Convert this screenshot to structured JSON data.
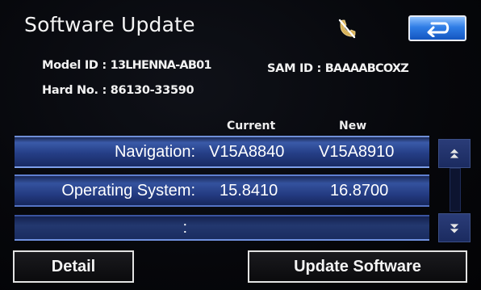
{
  "header": {
    "title": "Software Update"
  },
  "info": {
    "model_id_label": "Model ID :",
    "model_id_value": "13LHENNA-AB01",
    "sam_id_label": "SAM ID :",
    "sam_id_value": "BAAAABCOXZ",
    "hard_no_label": "Hard No. :",
    "hard_no_value": "86130-33590"
  },
  "table": {
    "columns": [
      "Current",
      "New"
    ],
    "rows": [
      {
        "label": "Navigation:",
        "current": "V15A8840",
        "new": "V15A8910"
      },
      {
        "label": "Operating System:",
        "current": "15.8410",
        "new": "16.8700"
      },
      {
        "label": ":",
        "current": "",
        "new": ""
      }
    ]
  },
  "buttons": {
    "detail": "Detail",
    "update": "Update Software"
  },
  "icons": {
    "status": "phone-disconnected-icon",
    "back": "back-arrow-icon",
    "scroll_up": "chevron-double-up-icon",
    "scroll_down": "chevron-double-down-icon"
  },
  "colors": {
    "row_accent": "#3a5aa8",
    "back_button": "#2f7de6",
    "phone_icon": "#d8b25a"
  }
}
